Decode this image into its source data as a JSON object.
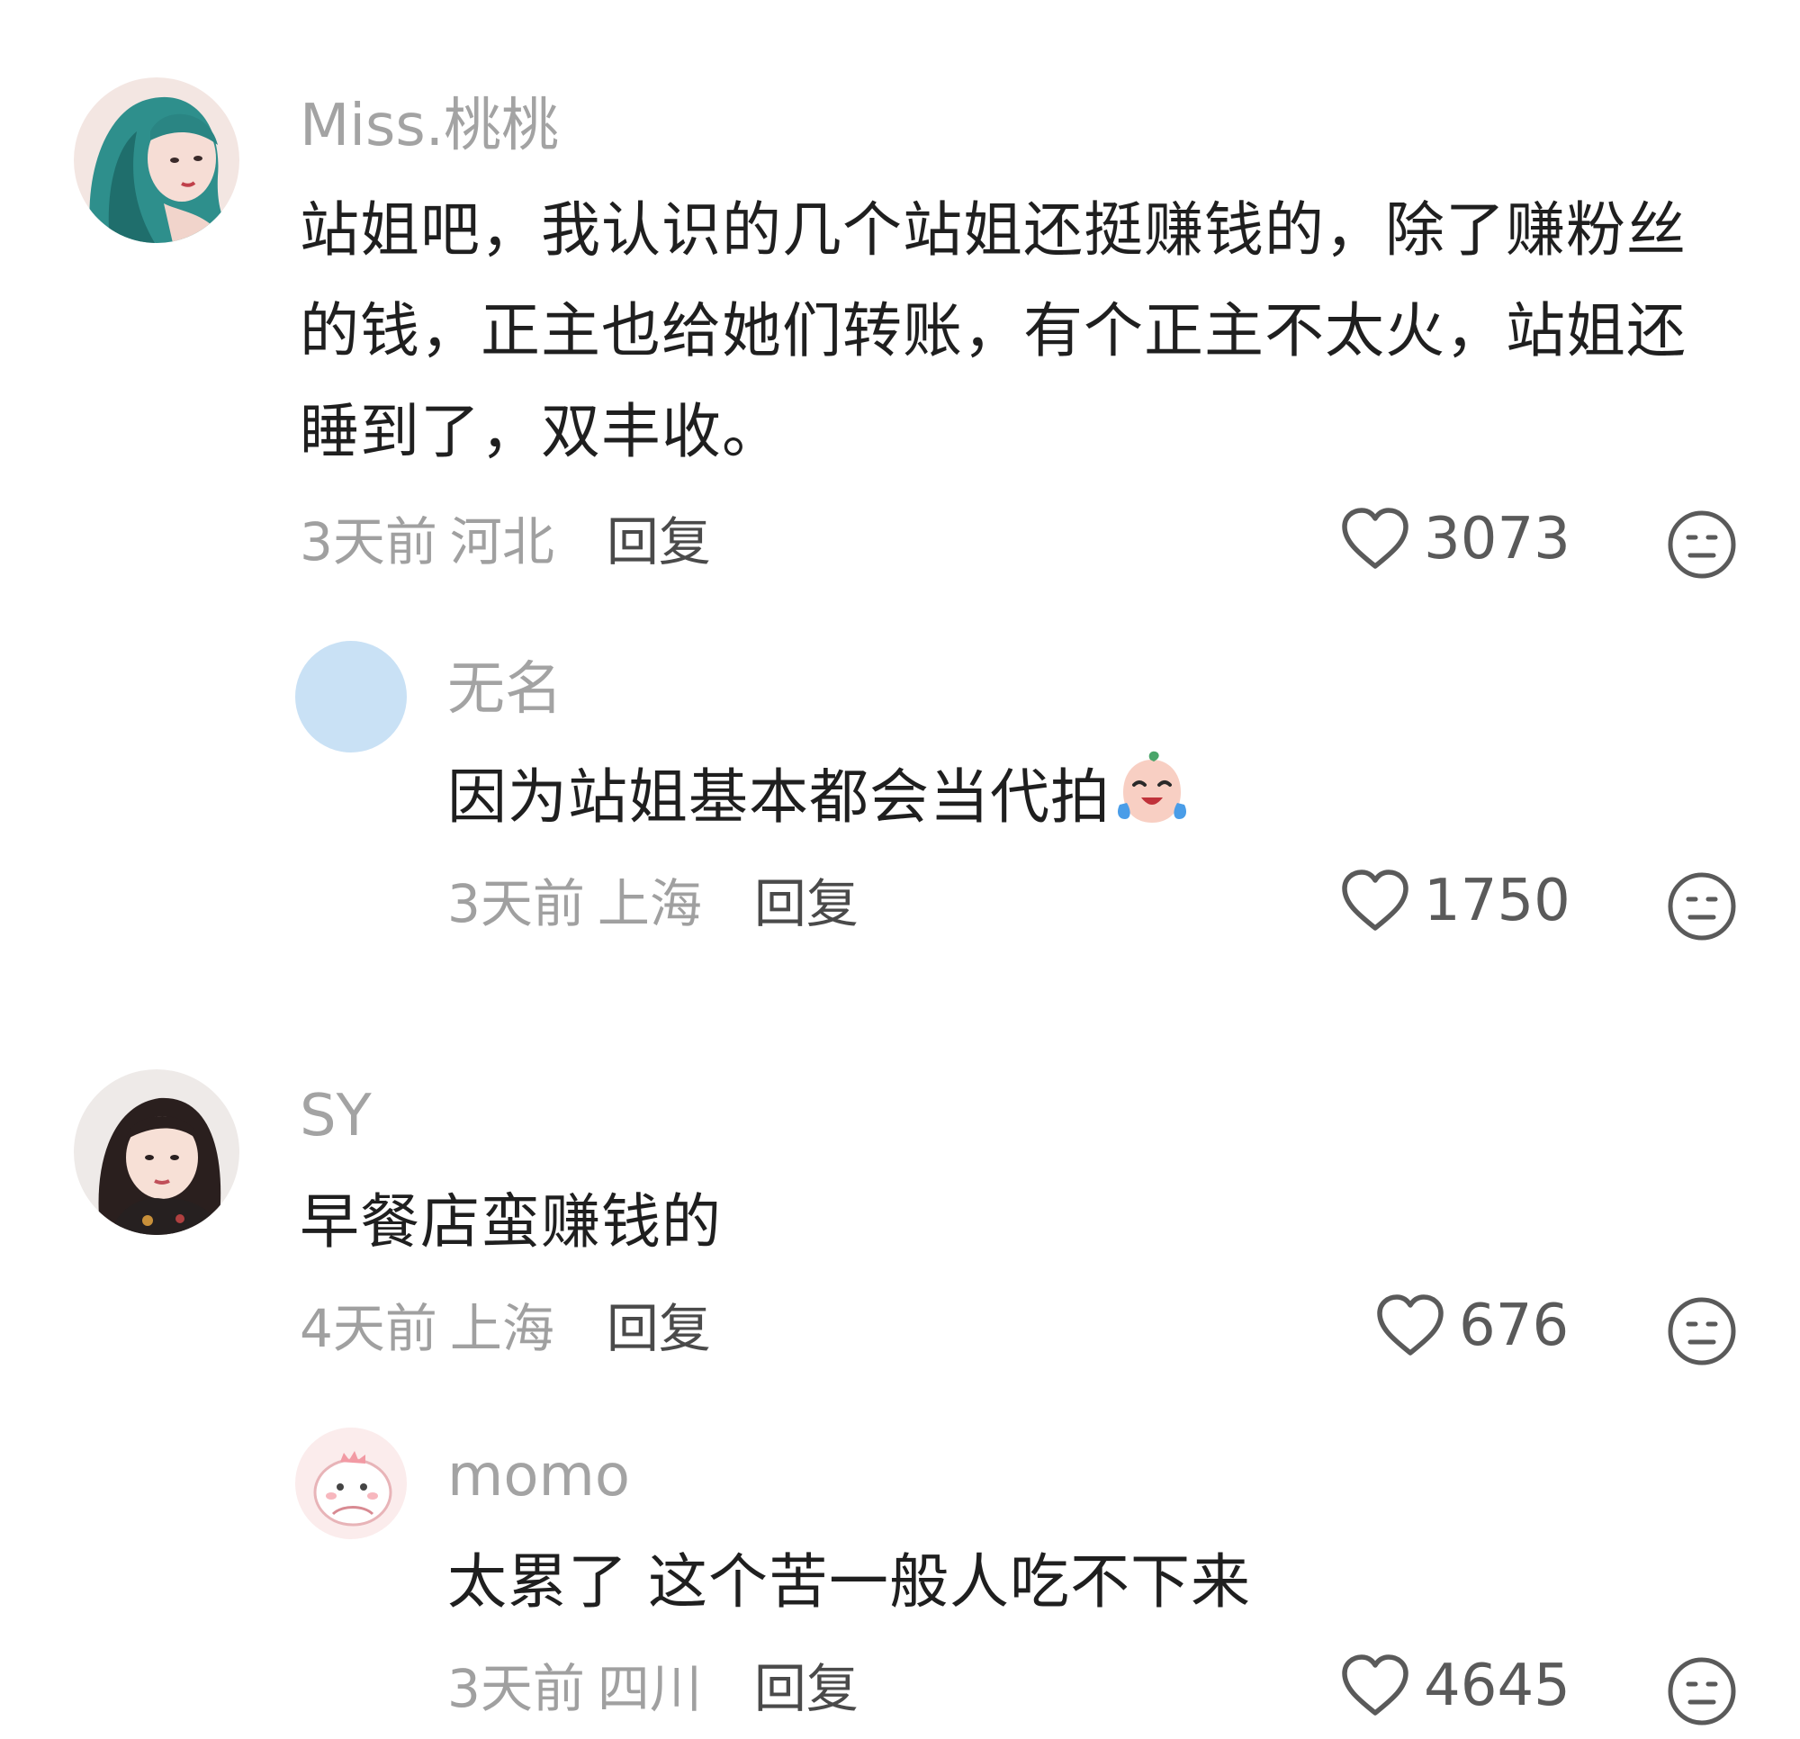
{
  "comments": [
    {
      "username": "Miss.桃桃",
      "text": "站姐吧，我认识的几个站姐还挺赚钱的，除了赚粉丝的钱，正主也给她们转账，有个正主不太火，站姐还睡到了，双丰收。",
      "time": "3天前",
      "location": "河北",
      "reply_label": "回复",
      "likes": "3073",
      "reply": {
        "username": "无名",
        "text": "因为站姐基本都会当代拍",
        "emoji": "crying-laughing-emoji",
        "time": "3天前",
        "location": "上海",
        "reply_label": "回复",
        "likes": "1750"
      }
    },
    {
      "username": "SY",
      "text": "早餐店蛮赚钱的",
      "time": "4天前",
      "location": "上海",
      "reply_label": "回复",
      "likes": "676",
      "reply": {
        "username": "momo",
        "text": "太累了 这个苦一般人吃不下来",
        "time": "3天前",
        "location": "四川",
        "reply_label": "回复",
        "likes": "4645"
      }
    }
  ],
  "colors": {
    "username": "#a3a3a3",
    "text": "#1f1f1f",
    "meta": "#a0a0a0",
    "reply_link": "#4a4a4a",
    "icon": "#5a5a5a",
    "anon_avatar": "#c9e1f5"
  }
}
